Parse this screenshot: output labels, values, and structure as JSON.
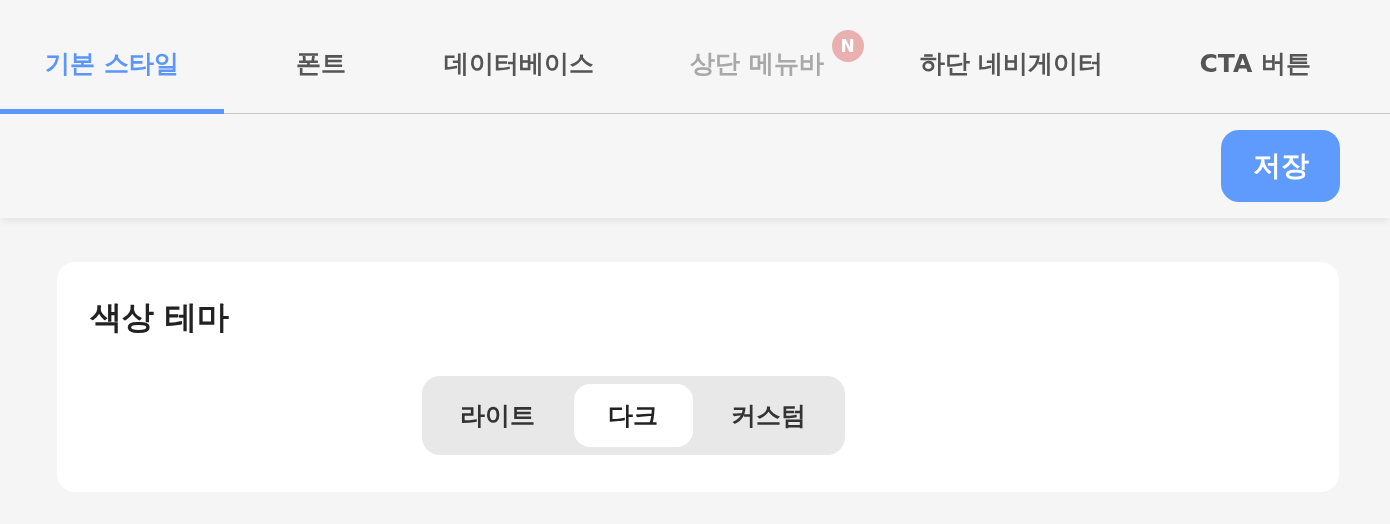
{
  "tabs": [
    {
      "label": "기본 스타일",
      "selected": true,
      "disabled": false
    },
    {
      "label": "폰트",
      "selected": false,
      "disabled": false
    },
    {
      "label": "데이터베이스",
      "selected": false,
      "disabled": false
    },
    {
      "label": "상단 메뉴바",
      "selected": false,
      "disabled": true,
      "badge": "N"
    },
    {
      "label": "하단 네비게이터",
      "selected": false,
      "disabled": false
    },
    {
      "label": "CTA 버튼",
      "selected": false,
      "disabled": false
    }
  ],
  "toolbar": {
    "save_button": "저장"
  },
  "theme_card": {
    "title": "색상 테마",
    "options": [
      {
        "label": "라이트",
        "selected": false
      },
      {
        "label": "다크",
        "selected": true
      },
      {
        "label": "커스텀",
        "selected": false
      }
    ]
  }
}
